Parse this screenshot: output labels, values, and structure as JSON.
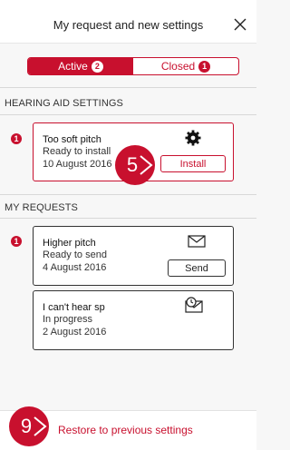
{
  "header": {
    "title": "My request and new settings",
    "close_icon": "close-icon"
  },
  "tabs": [
    {
      "label": "Active",
      "badge": "2",
      "selected": true
    },
    {
      "label": "Closed",
      "badge": "1",
      "selected": false
    }
  ],
  "sections": {
    "hearing_aid_settings": "HEARING AID SETTINGS",
    "my_requests": "MY REQUESTS"
  },
  "settings_cards": [
    {
      "alert": "1",
      "title": "Too soft pitch",
      "status": "Ready to install",
      "date": "10 August 2016",
      "button": "Install",
      "icon": "gear-icon"
    }
  ],
  "request_cards": [
    {
      "alert": "1",
      "title": "Higher pitch",
      "status": "Ready to send",
      "date": "4 August 2016",
      "button": "Send",
      "icon": "envelope-icon"
    },
    {
      "alert": "",
      "title": "I can't hear sp",
      "status": "In progress",
      "date": "2 August 2016",
      "button": "",
      "icon": "clock-envelope-icon"
    }
  ],
  "step_markers": [
    "5",
    "9"
  ],
  "footer": {
    "link": "Restore to previous settings"
  },
  "colors": {
    "accent": "#c8102e",
    "background": "#f7f7f7"
  }
}
